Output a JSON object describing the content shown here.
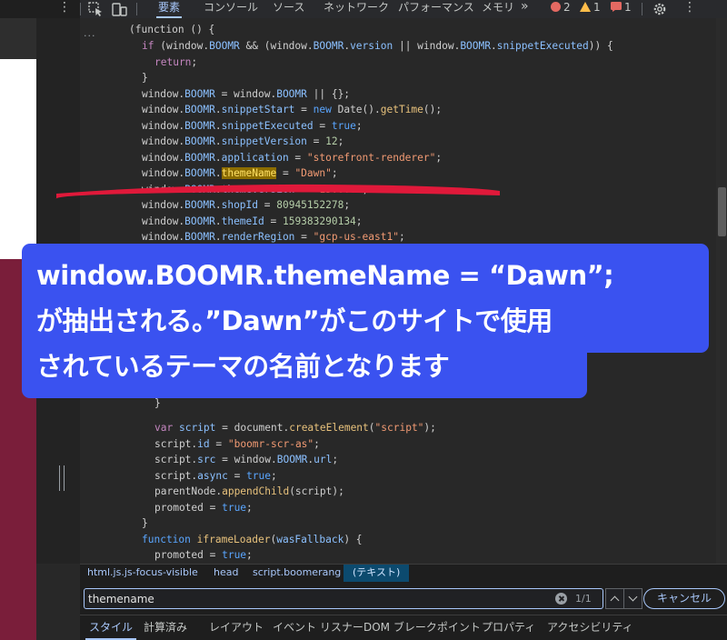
{
  "toolbar": {
    "more_icon": "kebab-vertical-icon",
    "inspect_icon": "inspect-element-icon",
    "device_icon": "device-toolbar-icon",
    "tabs": [
      {
        "label": "要素",
        "active": true
      },
      {
        "label": "コンソール",
        "active": false
      },
      {
        "label": "ソース",
        "active": false
      },
      {
        "label": "ネットワーク",
        "active": false
      },
      {
        "label": "パフォーマンス",
        "active": false
      },
      {
        "label": "メモリ",
        "active": false
      }
    ],
    "overflow_label": "»",
    "errors": {
      "count": "2",
      "color": "#e46962"
    },
    "warnings": {
      "count": "1",
      "color": "#ffbd4a"
    },
    "issues": {
      "count": "1",
      "color": "#e46962"
    },
    "settings_icon": "gear-icon"
  },
  "code": {
    "collapsed_marker": "...",
    "lines": [
      [
        [
          "ob",
          "(function () {"
        ]
      ],
      [
        [
          "kw",
          "if"
        ],
        [
          "ob",
          " (window."
        ],
        [
          "pr",
          "BOOMR"
        ],
        [
          "ob",
          " && (window."
        ],
        [
          "pr",
          "BOOMR"
        ],
        [
          "ob",
          "."
        ],
        [
          "pr",
          "version"
        ],
        [
          "ob",
          " || window."
        ],
        [
          "pr",
          "BOOMR"
        ],
        [
          "ob",
          "."
        ],
        [
          "pr",
          "snippetExecuted"
        ],
        [
          "ob",
          ")) {"
        ]
      ],
      [
        [
          "kw",
          "return"
        ],
        [
          "ob",
          ";"
        ]
      ],
      [
        [
          "ob",
          "}"
        ]
      ],
      [
        [
          "ob",
          "window."
        ],
        [
          "pr",
          "BOOMR"
        ],
        [
          "ob",
          " = window."
        ],
        [
          "pr",
          "BOOMR"
        ],
        [
          "ob",
          " || {};"
        ]
      ],
      [
        [
          "ob",
          "window."
        ],
        [
          "pr",
          "BOOMR"
        ],
        [
          "ob",
          "."
        ],
        [
          "pr",
          "snippetStart"
        ],
        [
          "ob",
          " = "
        ],
        [
          "kw2",
          "new"
        ],
        [
          "ob",
          " Date()."
        ],
        [
          "fn",
          "getTime"
        ],
        [
          "ob",
          "();"
        ]
      ],
      [
        [
          "ob",
          "window."
        ],
        [
          "pr",
          "BOOMR"
        ],
        [
          "ob",
          "."
        ],
        [
          "pr",
          "snippetExecuted"
        ],
        [
          "ob",
          " = "
        ],
        [
          "kw2",
          "true"
        ],
        [
          "ob",
          ";"
        ]
      ],
      [
        [
          "ob",
          "window."
        ],
        [
          "pr",
          "BOOMR"
        ],
        [
          "ob",
          "."
        ],
        [
          "pr",
          "snippetVersion"
        ],
        [
          "ob",
          " = "
        ],
        [
          "nu",
          "12"
        ],
        [
          "ob",
          ";"
        ]
      ],
      [
        [
          "ob",
          "window."
        ],
        [
          "pr",
          "BOOMR"
        ],
        [
          "ob",
          "."
        ],
        [
          "pr",
          "application"
        ],
        [
          "ob",
          " = "
        ],
        [
          "st",
          "\"storefront-renderer\""
        ],
        [
          "ob",
          ";"
        ]
      ],
      [
        [
          "ob",
          "window."
        ],
        [
          "pr",
          "BOOMR"
        ],
        [
          "ob",
          "."
        ],
        [
          "hl",
          "themeName"
        ],
        [
          "ob",
          " = "
        ],
        [
          "st",
          "\"Dawn\""
        ],
        [
          "ob",
          ";"
        ]
      ],
      [
        [
          "ob",
          "window."
        ],
        [
          "pr",
          "BOOMR"
        ],
        [
          "ob",
          "."
        ],
        [
          "pr",
          "themeVersion"
        ],
        [
          "ob",
          " = "
        ],
        [
          "st",
          "\"15.0.0\""
        ],
        [
          "ob",
          ";"
        ]
      ],
      [
        [
          "ob",
          "window."
        ],
        [
          "pr",
          "BOOMR"
        ],
        [
          "ob",
          "."
        ],
        [
          "pr",
          "shopId"
        ],
        [
          "ob",
          " = "
        ],
        [
          "nu",
          "80945152278"
        ],
        [
          "ob",
          ";"
        ]
      ],
      [
        [
          "ob",
          "window."
        ],
        [
          "pr",
          "BOOMR"
        ],
        [
          "ob",
          "."
        ],
        [
          "pr",
          "themeId"
        ],
        [
          "ob",
          " = "
        ],
        [
          "nu",
          "159383290134"
        ],
        [
          "ob",
          ";"
        ]
      ],
      [
        [
          "ob",
          "window."
        ],
        [
          "pr",
          "BOOMR"
        ],
        [
          "ob",
          "."
        ],
        [
          "pr",
          "renderRegion"
        ],
        [
          "ob",
          " = "
        ],
        [
          "st",
          "\"gcp-us-east1\""
        ],
        [
          "ob",
          ";"
        ]
      ],
      [
        [
          "ob",
          "}"
        ]
      ],
      [
        [
          "kw",
          "var"
        ],
        [
          "ob",
          " "
        ],
        [
          "pr",
          "script"
        ],
        [
          "ob",
          " = document."
        ],
        [
          "fn",
          "createElement"
        ],
        [
          "ob",
          "("
        ],
        [
          "st",
          "\"script\""
        ],
        [
          "ob",
          ");"
        ]
      ],
      [
        [
          "ob",
          "script."
        ],
        [
          "pr",
          "id"
        ],
        [
          "ob",
          " = "
        ],
        [
          "st",
          "\"boomr-scr-as\""
        ],
        [
          "ob",
          ";"
        ]
      ],
      [
        [
          "ob",
          "script."
        ],
        [
          "pr",
          "src"
        ],
        [
          "ob",
          " = window."
        ],
        [
          "pr",
          "BOOMR"
        ],
        [
          "ob",
          "."
        ],
        [
          "pr",
          "url"
        ],
        [
          "ob",
          ";"
        ]
      ],
      [
        [
          "ob",
          "script."
        ],
        [
          "pr",
          "async"
        ],
        [
          "ob",
          " = "
        ],
        [
          "kw2",
          "true"
        ],
        [
          "ob",
          ";"
        ]
      ],
      [
        [
          "ob",
          "parentNode."
        ],
        [
          "fn",
          "appendChild"
        ],
        [
          "ob",
          "(script);"
        ]
      ],
      [
        [
          "ob",
          "promoted = "
        ],
        [
          "kw2",
          "true"
        ],
        [
          "ob",
          ";"
        ]
      ],
      [
        [
          "ob",
          "}"
        ]
      ],
      [
        [
          "kw2",
          "function"
        ],
        [
          "ob",
          " "
        ],
        [
          "fn",
          "iframeLoader"
        ],
        [
          "ob",
          "("
        ],
        [
          "pr",
          "wasFallback"
        ],
        [
          "ob",
          ") {"
        ]
      ],
      [
        [
          "ob",
          "promoted = "
        ],
        [
          "kw2",
          "true"
        ],
        [
          "ob",
          ";"
        ]
      ]
    ]
  },
  "annotation": {
    "line1": "window.BOOMR.themeName = “Dawn”;",
    "line2": "が抽出される。”Dawn”がこのサイトで使用",
    "line3": "されているテーマの名前となります",
    "bubble_color": "#3a52f0",
    "underline_color": "#e0193a"
  },
  "breadcrumb": [
    "html.js.js-focus-visible",
    "head",
    "script.boomerang",
    "(テキスト)"
  ],
  "search": {
    "value": "themename",
    "placeholder": "",
    "match_count": "1/1",
    "cancel_label": "キャンセル"
  },
  "bottom_tabs": [
    {
      "label": "スタイル",
      "active": true
    },
    {
      "label": "計算済み",
      "active": false
    },
    {
      "label": "レイアウト",
      "active": false
    },
    {
      "label": "イベント リスナー",
      "active": false
    },
    {
      "label": "DOM ブレークポイント",
      "active": false
    },
    {
      "label": "プロパティ",
      "active": false
    },
    {
      "label": "アクセシビリティ",
      "active": false
    }
  ]
}
